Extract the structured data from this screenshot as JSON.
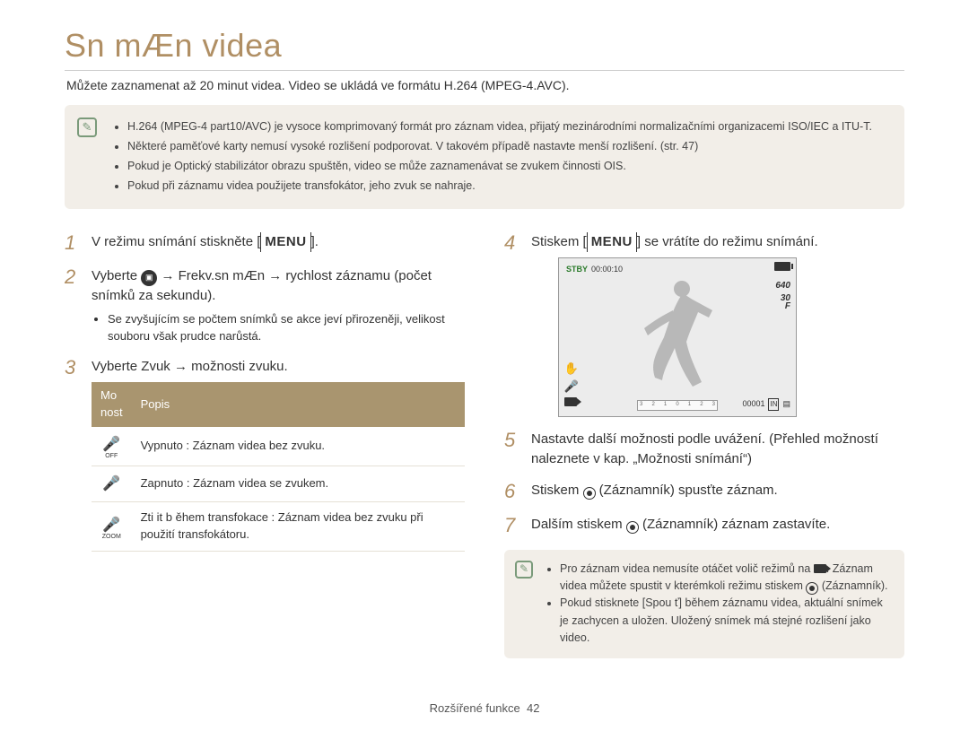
{
  "title": "Sn mÆn  videa",
  "intro": "Můžete zaznamenat až 20 minut videa. Video se ukládá ve formátu H.264 (MPEG-4.AVC).",
  "infobox": {
    "items": [
      "H.264 (MPEG-4 part10/AVC) je vysoce komprimovaný formát pro záznam videa, přijatý mezinárodními normalizačními organizacemi ISO/IEC a ITU-T.",
      "Některé paměťové karty nemusí vysoké rozlišení podporovat. V takovém případě nastavte menší rozlišení. (str. 47)",
      "Pokud je Optický stabilizátor obrazu spuštěn, video se může zaznamenávat se zvukem činnosti OIS.",
      "Pokud při záznamu videa použijete transfokátor, jeho zvuk se nahraje."
    ]
  },
  "left": {
    "step1_a": "V režimu snímání stiskněte [",
    "step1_menu": "MENU",
    "step1_b": "].",
    "step2_a": "Vyberte ",
    "step2_b": " → Frekv.sn mÆn  → rychlost záznamu (počet snímků za sekundu).",
    "step2_note": "Se zvyšujícím se počtem snímků se akce jeví přirozeněji, velikost souboru však prudce narůstá.",
    "step3": "Vyberte Zvuk → možnosti zvuku.",
    "table": {
      "head_option": "Mo nost",
      "head_desc": "Popis",
      "rows": [
        {
          "icon": "mic-off",
          "desc": "Vypnuto : Záznam videa bez zvuku."
        },
        {
          "icon": "mic-on",
          "desc": "Zapnuto : Záznam videa se zvukem."
        },
        {
          "icon": "mic-zoom",
          "desc": "Zti it b ěhem transfokace  : Záznam videa bez zvuku při použití transfokátoru."
        }
      ]
    }
  },
  "right": {
    "step4_a": "Stiskem [",
    "step4_menu": "MENU",
    "step4_b": "] se vrátíte do režimu snímání.",
    "screen": {
      "stby": "STBY",
      "time": "00:00:10",
      "res": "640",
      "fps_a": "30",
      "fps_b": "F",
      "counter": "00001"
    },
    "step5": "Nastavte další možnosti podle uvážení. (Přehled možností naleznete v kap. „Možnosti snímání“)",
    "step6_a": "Stiskem ",
    "step6_b": " (Záznamník) spusťte záznam.",
    "step7_a": "Dalším stiskem ",
    "step7_b": " (Záznamník) záznam zastavíte.",
    "sub_infobox": {
      "items": [
        {
          "a": "Pro záznam videa nemusíte otáčet volič režimů na ",
          "b": ". Záznam videa můžete spustit v kterémkoli režimu stiskem ",
          "c": " (Záznamník)."
        },
        {
          "a": "Pokud stisknete [Spou  ť] během záznamu videa, aktuální snímek je zachycen a uložen. Uložený snímek má stejné rozlišení jako video."
        }
      ]
    }
  },
  "footer": {
    "section": "Rozšířené funkce",
    "page": "42"
  }
}
